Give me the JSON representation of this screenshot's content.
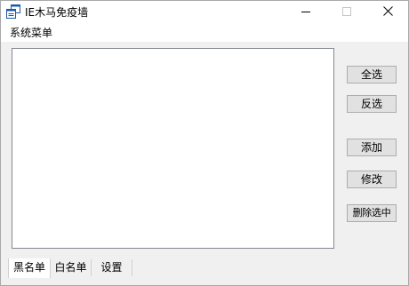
{
  "window": {
    "title": "IE木马免疫墙",
    "controls": {
      "minimize_icon": "minimize-icon",
      "maximize_icon": "maximize-icon",
      "close_icon": "close-icon"
    }
  },
  "menubar": {
    "items": [
      {
        "label": "系统菜单"
      }
    ]
  },
  "buttons": {
    "select_all": "全选",
    "invert": "反选",
    "add": "添加",
    "edit": "修改",
    "delete_selected": "删除选中"
  },
  "tabs": [
    {
      "label": "黑名单",
      "active": true
    },
    {
      "label": "白名单",
      "active": false
    },
    {
      "label": "设置",
      "active": false
    }
  ],
  "colors": {
    "window_bg": "#f0f0f0",
    "titlebar_bg": "#ffffff",
    "icon_blue": "#1e5aa8",
    "button_bg": "#e1e1e1"
  }
}
